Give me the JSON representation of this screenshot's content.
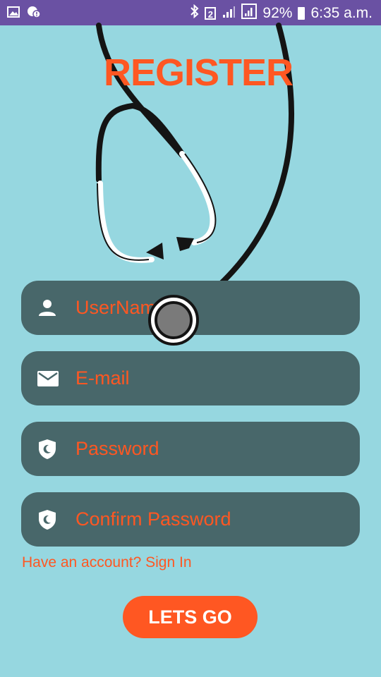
{
  "status_bar": {
    "battery": "92%",
    "time": "6:35 a.m.",
    "sim_slot": "2",
    "icons": [
      "image-icon",
      "location-alert-icon",
      "bluetooth-icon",
      "sim-2-icon",
      "signal-icon",
      "signal-icon",
      "battery-icon"
    ]
  },
  "title": "REGISTER",
  "fields": {
    "username": {
      "label": "UserName",
      "icon": "person-icon"
    },
    "email": {
      "label": "E-mail",
      "icon": "mail-icon"
    },
    "password": {
      "label": "Password",
      "icon": "shield-icon"
    },
    "confirm_password": {
      "label": "Confirm Password",
      "icon": "shield-icon"
    }
  },
  "signin_link": "Have an account? Sign In",
  "submit_button": "LETS GO",
  "colors": {
    "background": "#96d7e0",
    "status_bar": "#6a51a3",
    "accent": "#ff5722",
    "field": "#48676a"
  }
}
